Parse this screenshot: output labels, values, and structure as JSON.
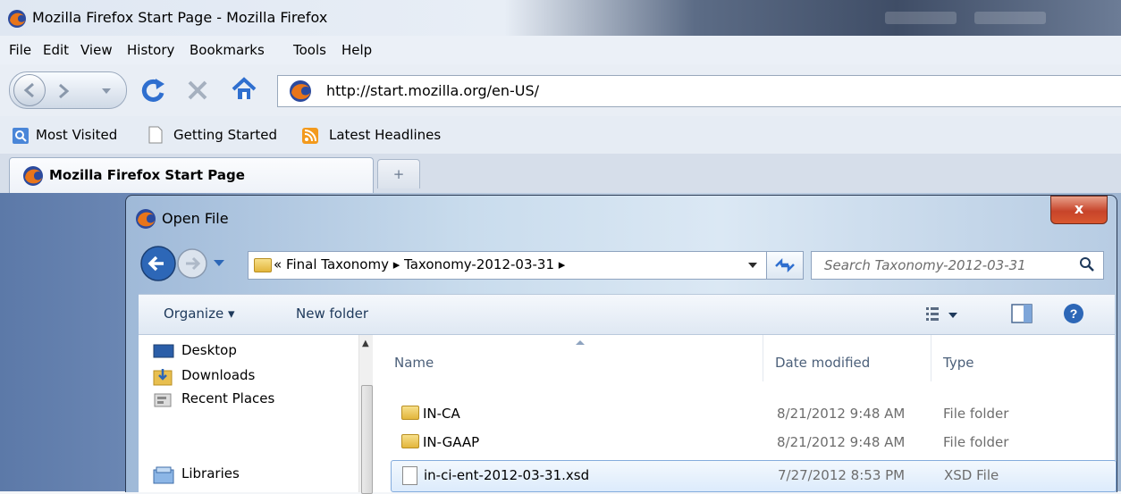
{
  "browser": {
    "window_title": "Mozilla Firefox Start Page - Mozilla Firefox",
    "menu": [
      "File",
      "Edit",
      "View",
      "History",
      "Bookmarks",
      "Tools",
      "Help"
    ],
    "url": "http://start.mozilla.org/en-US/",
    "bookmarks": [
      {
        "label": "Most Visited",
        "icon": "most-visited-icon"
      },
      {
        "label": "Getting Started",
        "icon": "page-icon"
      },
      {
        "label": "Latest Headlines",
        "icon": "rss-icon"
      }
    ],
    "tab_title": "Mozilla Firefox Start Page",
    "new_tab_glyph": "+"
  },
  "dialog": {
    "title": "Open File",
    "close_glyph": "x",
    "breadcrumb": {
      "prefix": "«",
      "parts": [
        "Final Taxonomy",
        "Taxonomy-2012-03-31"
      ],
      "separator": "▸"
    },
    "search_placeholder": "Search Taxonomy-2012-03-31",
    "commands": {
      "organize": "Organize ▾",
      "new_folder": "New folder"
    },
    "nav_items": [
      {
        "label": "Desktop",
        "icon": "desktop-icon"
      },
      {
        "label": "Downloads",
        "icon": "downloads-icon"
      },
      {
        "label": "Recent Places",
        "icon": "recent-places-icon"
      },
      {
        "label": "Libraries",
        "icon": "libraries-icon"
      }
    ],
    "columns": {
      "name": "Name",
      "date": "Date modified",
      "type": "Type"
    },
    "files": [
      {
        "name": "IN-CA",
        "date": "8/21/2012 9:48 AM",
        "type": "File folder",
        "icon": "folder-icon",
        "selected": false
      },
      {
        "name": "IN-GAAP",
        "date": "8/21/2012 9:48 AM",
        "type": "File folder",
        "icon": "folder-icon",
        "selected": false
      },
      {
        "name": "in-ci-ent-2012-03-31.xsd",
        "date": "7/27/2012 8:53 PM",
        "type": "XSD File",
        "icon": "file-icon",
        "selected": true
      }
    ]
  },
  "colors": {
    "accent": "#3b6fb5",
    "close_red": "#c7442a",
    "selection": "#dcebfc"
  }
}
